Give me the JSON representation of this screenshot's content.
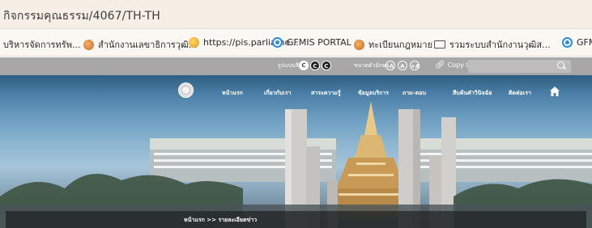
{
  "browser": {
    "url": "กิจกรรมคุณธรรม/4067/TH-TH",
    "bookmarks": [
      {
        "label": "บริหารจัดการทรัพ...",
        "icon": "none"
      },
      {
        "label": "สำนักงานเลขาธิการวุฒิ...",
        "icon": "orange-circle-icon"
      },
      {
        "label": "https://pis.parliame...",
        "icon": "yellow-circle-icon"
      },
      {
        "label": "GFMIS PORTAL",
        "icon": "gfmis-icon"
      },
      {
        "label": "ทะเบียนกฎหมาย",
        "icon": "orange-circle-icon"
      },
      {
        "label": "รวมระบบสำนักงานวุฒิส...",
        "icon": "folder-icon"
      },
      {
        "label": "GFM",
        "icon": "gfmis-icon"
      }
    ]
  },
  "site": {
    "topbar": {
      "theme_label": "รูปแบบสี",
      "theme_buttons": [
        "C",
        "C",
        "C"
      ],
      "fontsize_label": "ขนาดตัวอักษร",
      "fontsize_buttons": [
        "-A",
        "A",
        "+A"
      ],
      "copy_link_label": "Copy link",
      "search_placeholder": ""
    },
    "nav": {
      "items": [
        "หน้าแรก",
        "เกี่ยวกับเรา",
        "สาระความรู้",
        "ข้อมูลบริการ",
        "ถาม-ตอบ",
        "สืบค้นคำวินิจฉัย",
        "ติดต่อเรา"
      ]
    },
    "breadcrumb": "หน้าแรก >> รายละเอียดข่าว"
  },
  "colors": {
    "address_bar_bg": "#f7efe6",
    "topbar_bg": "#a7a7a7",
    "breadcrumb_bg": "#191919"
  }
}
